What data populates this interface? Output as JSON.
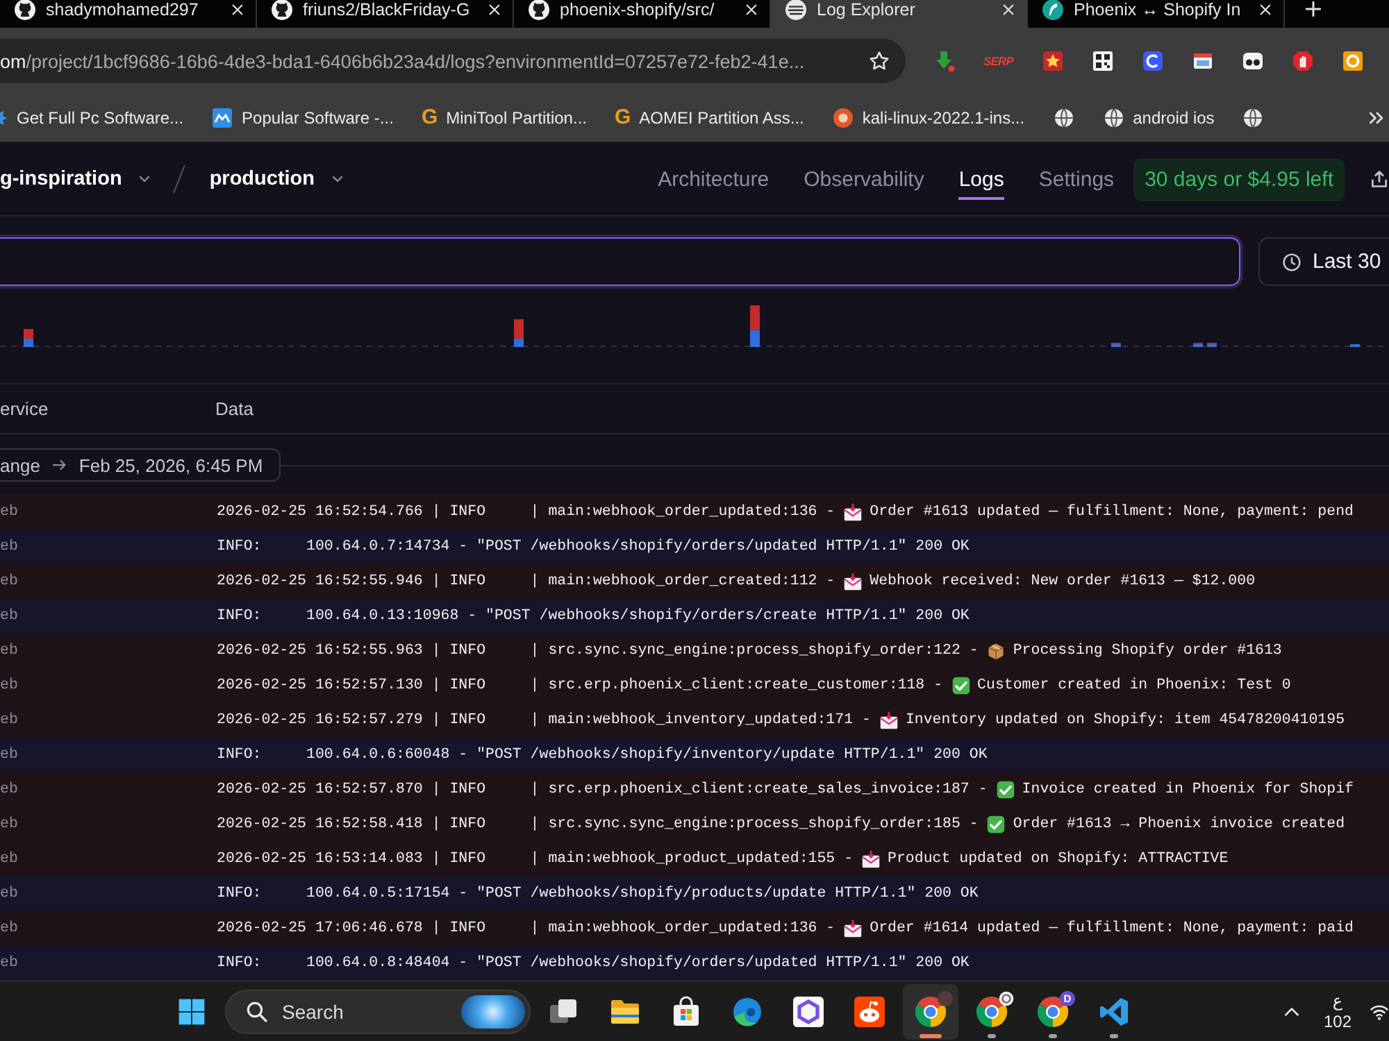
{
  "browser": {
    "tabs": [
      {
        "title": "shadymohamed297",
        "kind": "cat",
        "selected": false
      },
      {
        "title": "friuns2/BlackFriday-G",
        "kind": "cat",
        "selected": false
      },
      {
        "title": "phoenix-shopify/src/",
        "kind": "cat",
        "selected": false
      },
      {
        "title": "Log Explorer",
        "kind": "disc",
        "selected": true
      },
      {
        "title": "Phoenix ↔ Shopify In",
        "kind": "feather",
        "selected": false
      }
    ],
    "address": {
      "host": "om",
      "path": "/project/1bcf9686-16b6-4de3-bda1-6406b6b23a4d/logs?environmentId=07257e72-feb2-41e..."
    },
    "extensions": [
      {
        "kind": "arrow"
      },
      {
        "kind": "text",
        "text": "SERP"
      },
      {
        "kind": "star"
      },
      {
        "kind": "qr"
      },
      {
        "kind": "tile"
      },
      {
        "kind": "window"
      },
      {
        "kind": "goggles"
      },
      {
        "kind": "hand"
      },
      {
        "kind": "ring"
      }
    ],
    "bookmarks": [
      {
        "kind": "burst",
        "label": "Get Full Pc Software..."
      },
      {
        "kind": "tile",
        "label": "Popular Software -..."
      },
      {
        "kind": "letter",
        "letter": "G",
        "label": "MiniTool Partition..."
      },
      {
        "kind": "letter",
        "letter": "G",
        "label": "AOMEI Partition Ass..."
      },
      {
        "kind": "badge",
        "label": "kali-linux-2022.1-ins..."
      },
      {
        "kind": "globe"
      },
      {
        "kind": "globe",
        "label": "android ios"
      },
      {
        "kind": "globe"
      }
    ]
  },
  "app": {
    "project": "g-inspiration",
    "environment": "production",
    "nav": [
      {
        "label": "Architecture",
        "selected": false
      },
      {
        "label": "Observability",
        "selected": false
      },
      {
        "label": "Logs",
        "selected": true
      },
      {
        "label": "Settings",
        "selected": false
      }
    ],
    "trial_badge": "30 days or $4.95 left"
  },
  "search": {
    "focused": true
  },
  "time_range": "Last 30",
  "columns": [
    {
      "label": "ervice"
    },
    {
      "label": "Data"
    }
  ],
  "range_separator": {
    "start": "ange",
    "end": "Feb 25, 2026, 6:45 PM"
  },
  "rows": [
    {
      "kind": "error",
      "service": "eb",
      "text": "2026-02-25 16:52:54.766 | INFO     | main:webhook_order_updated:136 -",
      "emoji": {
        "kind": "envelope"
      },
      "message": "Order #1613 updated — fulfillment: None, payment: pend"
    },
    {
      "kind": "info",
      "service": "eb",
      "text": "INFO:     100.64.0.7:14734 - \"POST /webhooks/shopify/orders/updated HTTP/1.1\" 200 OK"
    },
    {
      "kind": "error",
      "service": "eb",
      "text": "2026-02-25 16:52:55.946 | INFO     | main:webhook_order_created:112 -",
      "emoji": {
        "kind": "envelope"
      },
      "message": "Webhook received: New order #1613 — $12.000"
    },
    {
      "kind": "info",
      "service": "eb",
      "text": "INFO:     100.64.0.13:10968 - \"POST /webhooks/shopify/orders/create HTTP/1.1\" 200 OK"
    },
    {
      "kind": "error",
      "service": "eb",
      "text": "2026-02-25 16:52:55.963 | INFO     | src.sync.sync_engine:process_shopify_order:122 -",
      "emoji": {
        "kind": "package"
      },
      "message": "Processing Shopify order #1613"
    },
    {
      "kind": "error",
      "service": "eb",
      "text": "2026-02-25 16:52:57.130 | INFO     | src.erp.phoenix_client:create_customer:118 -",
      "emoji": {
        "kind": "check"
      },
      "message": "Customer created in Phoenix: Test 0"
    },
    {
      "kind": "error",
      "service": "eb",
      "text": "2026-02-25 16:52:57.279 | INFO     | main:webhook_inventory_updated:171 -",
      "emoji": {
        "kind": "envelope"
      },
      "message": "Inventory updated on Shopify: item 45478200410195"
    },
    {
      "kind": "info",
      "service": "eb",
      "text": "INFO:     100.64.0.6:60048 - \"POST /webhooks/shopify/inventory/update HTTP/1.1\" 200 OK"
    },
    {
      "kind": "error",
      "service": "eb",
      "text": "2026-02-25 16:52:57.870 | INFO     | src.erp.phoenix_client:create_sales_invoice:187 -",
      "emoji": {
        "kind": "check"
      },
      "message": "Invoice created in Phoenix for Shopif"
    },
    {
      "kind": "error",
      "service": "eb",
      "text": "2026-02-25 16:52:58.418 | INFO     | src.sync.sync_engine:process_shopify_order:185 -",
      "emoji": {
        "kind": "check"
      },
      "message": "Order #1613 → Phoenix invoice created"
    },
    {
      "kind": "error",
      "service": "eb",
      "text": "2026-02-25 16:53:14.083 | INFO     | main:webhook_product_updated:155 -",
      "emoji": {
        "kind": "envelope"
      },
      "message": "Product updated on Shopify: ATTRACTIVE"
    },
    {
      "kind": "info",
      "service": "eb",
      "text": "INFO:     100.64.0.5:17154 - \"POST /webhooks/shopify/products/update HTTP/1.1\" 200 OK"
    },
    {
      "kind": "error",
      "service": "eb",
      "text": "2026-02-25 17:06:46.678 | INFO     | main:webhook_order_updated:136 -",
      "emoji": {
        "kind": "envelope"
      },
      "message": "Order #1614 updated — fulfillment: None, payment: paid"
    },
    {
      "kind": "info",
      "service": "eb",
      "text": "INFO:     100.64.0.8:48404 - \"POST /webhooks/shopify/orders/updated HTTP/1.1\" 200 OK"
    }
  ],
  "taskbar": {
    "search_label": "Search",
    "apps": [
      {
        "kind": "taskview",
        "running": false,
        "selected": false
      },
      {
        "kind": "folder",
        "running": false,
        "selected": false
      },
      {
        "kind": "store",
        "running": false,
        "selected": false
      },
      {
        "kind": "edge",
        "running": false,
        "selected": false
      },
      {
        "kind": "hexagon",
        "running": false,
        "selected": false
      },
      {
        "kind": "alien",
        "running": false,
        "selected": false
      },
      {
        "kind": "browser",
        "running": true,
        "selected": true,
        "profile": {
          "kind": "photo"
        }
      },
      {
        "kind": "browser",
        "running": true,
        "selected": false,
        "profile": {
          "kind": "ring"
        }
      },
      {
        "kind": "browser",
        "running": true,
        "selected": false,
        "profile": {
          "kind": "letter",
          "text": "D"
        }
      },
      {
        "kind": "editor",
        "running": true,
        "selected": false
      }
    ],
    "tray": {
      "line_1": "ع",
      "line_2": "102"
    }
  }
}
